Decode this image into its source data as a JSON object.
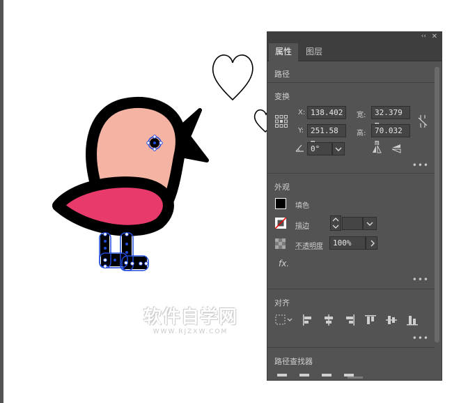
{
  "panel": {
    "tabs": [
      {
        "label": "属性"
      },
      {
        "label": "图层"
      }
    ],
    "collapse_glyph": "‹‹",
    "close_glyph": "✕",
    "more_glyph": "•••"
  },
  "path_section": {
    "title": "路径"
  },
  "transform": {
    "title": "变换",
    "x_label": "X:",
    "x_value": "138.402",
    "y_label": "Y:",
    "y_value": "251.58 m",
    "w_label": "宽:",
    "w_value": "32.379 m",
    "h_label": "高:",
    "h_value": "70.032 m",
    "angle_value": "0°"
  },
  "appearance": {
    "title": "外观",
    "fill_label": "填色",
    "stroke_label": "描边",
    "opacity_label": "不透明度",
    "opacity_value": "100%",
    "fx_label": "fx."
  },
  "align": {
    "title": "对齐"
  },
  "pathfinder": {
    "title": "路径查找器"
  },
  "watermark": {
    "main": "软件自学网",
    "sub": "WWW.RJZXW.COM"
  },
  "colors": {
    "panel_bg": "#535353",
    "bird_body": "#f4b3a3",
    "bird_wing": "#e83a6b",
    "outline": "#000000",
    "selection": "#1f49d8"
  }
}
